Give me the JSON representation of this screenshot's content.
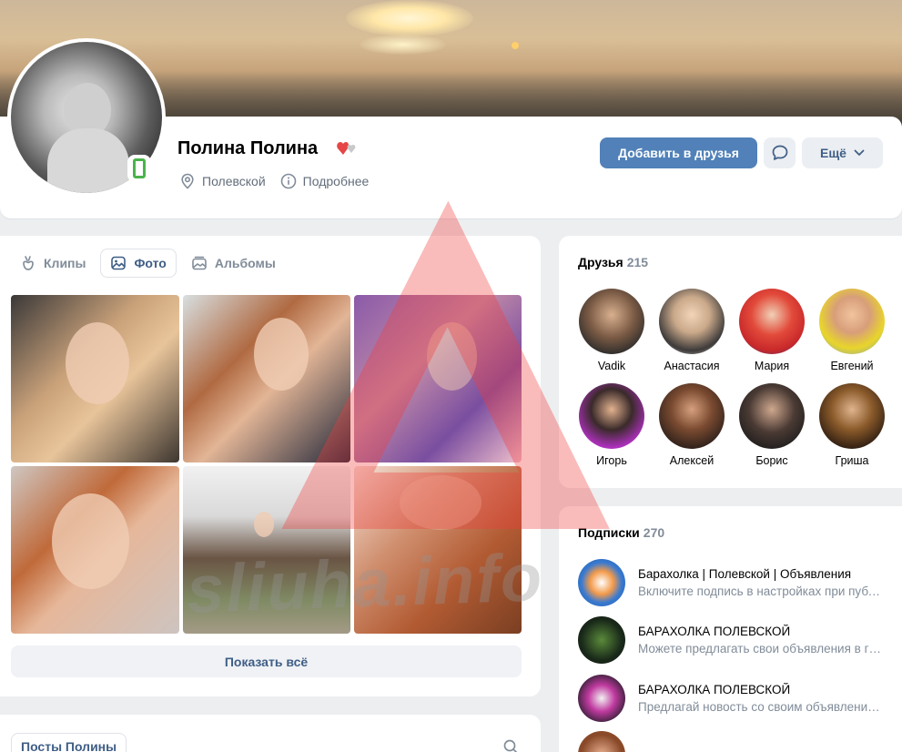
{
  "profile": {
    "name": "Полина Полина",
    "location": "Полевской",
    "details_label": "Подробнее"
  },
  "actions": {
    "add_friend_label": "Добавить в друзья",
    "more_label": "Ещё"
  },
  "media": {
    "tabs": [
      {
        "label": "Клипы",
        "active": false
      },
      {
        "label": "Фото",
        "active": true
      },
      {
        "label": "Альбомы",
        "active": false
      }
    ],
    "show_all_label": "Показать всё"
  },
  "posts": {
    "tab_label": "Посты Полины"
  },
  "friends": {
    "title": "Друзья",
    "count": "215",
    "items": [
      {
        "name": "Vadik"
      },
      {
        "name": "Анастасия"
      },
      {
        "name": "Мария"
      },
      {
        "name": "Евгений"
      },
      {
        "name": "Игорь"
      },
      {
        "name": "Алексей"
      },
      {
        "name": "Борис"
      },
      {
        "name": "Гриша"
      }
    ]
  },
  "subscriptions": {
    "title": "Подписки",
    "count": "270",
    "items": [
      {
        "title": "Барахолка | Полевской | Объявления",
        "desc": "Включите подпись в настройках при публикации"
      },
      {
        "title": "БАРАХОЛКА ПОЛЕВСКОЙ",
        "desc": "Можете предлагать свои объявления в группе"
      },
      {
        "title": "БАРАХОЛКА ПОЛЕВСКОЙ",
        "desc": "Предлагай новость со своим объявлением"
      }
    ]
  },
  "watermark": {
    "text": "sliuha.info"
  },
  "colors": {
    "accent": "#5181b8",
    "link": "#3f5e86",
    "secondary_text": "#818c99",
    "online": "#4bb34b",
    "page_bg": "#edeef0"
  }
}
